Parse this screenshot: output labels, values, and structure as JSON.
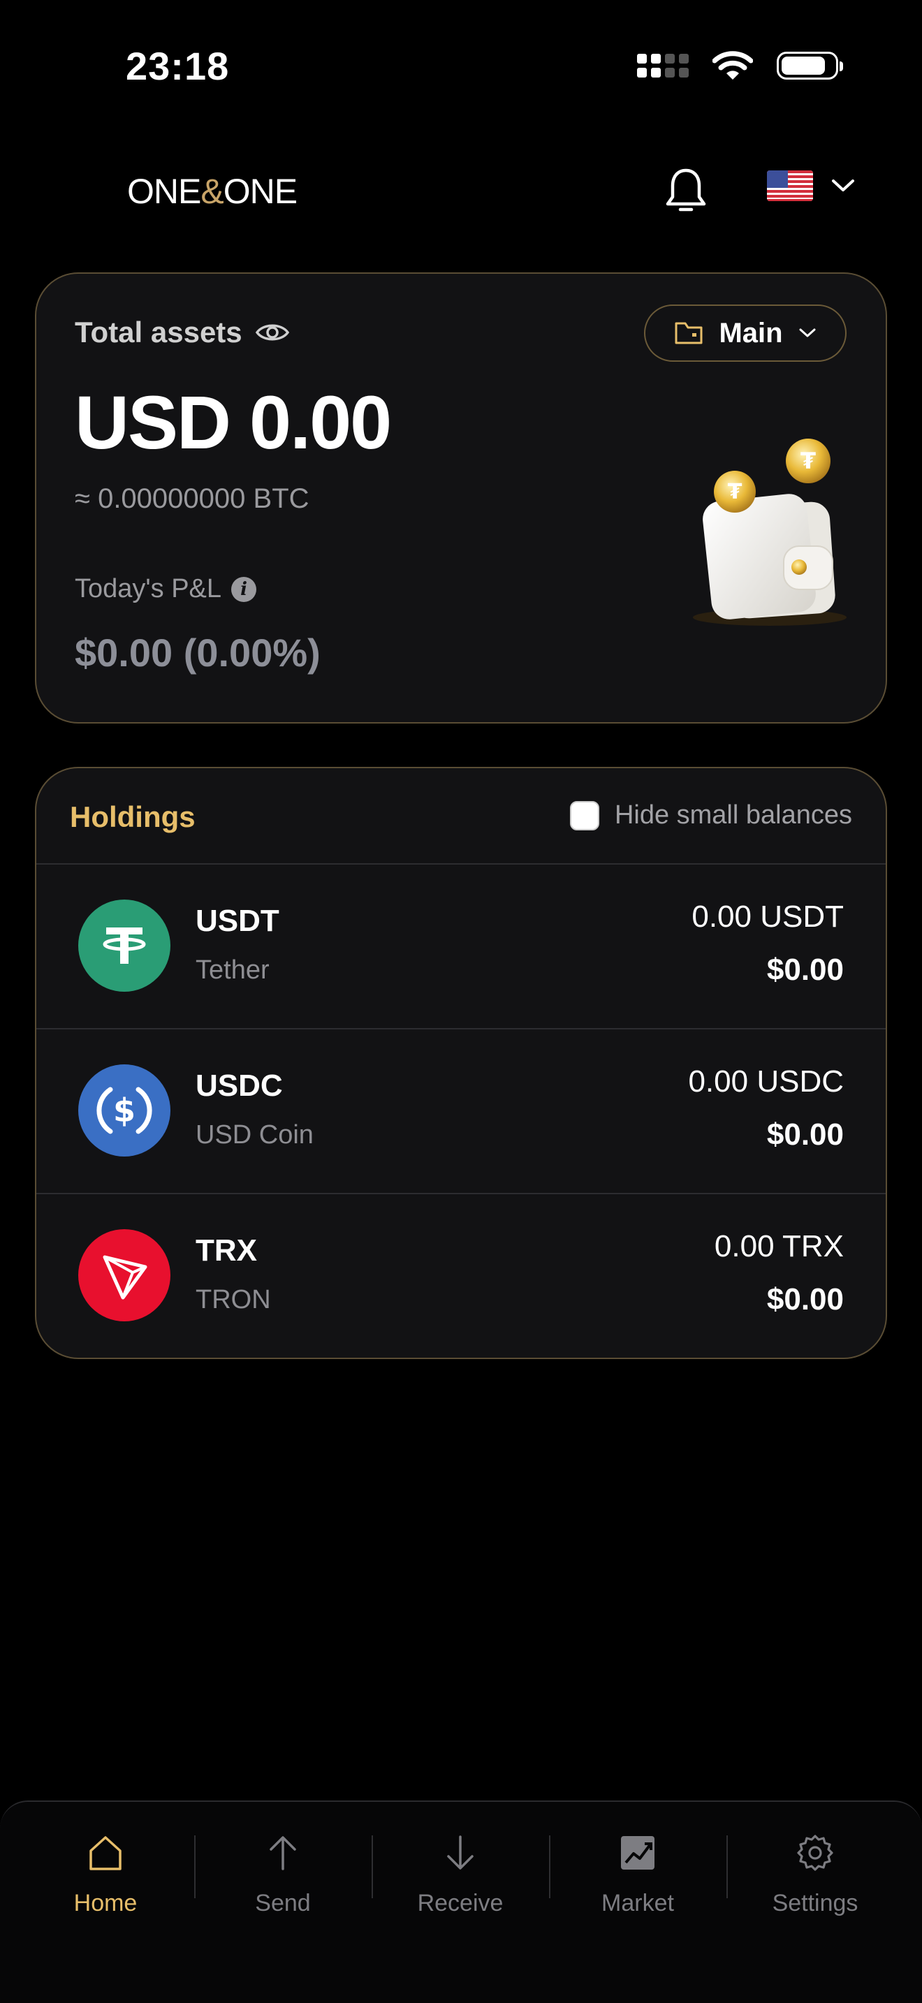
{
  "status_bar": {
    "time": "23:18"
  },
  "header": {
    "logo_text_a": "ONE",
    "logo_text_amp": "&",
    "logo_text_b": "ONE",
    "icons": [
      "bell-icon",
      "us-flag-icon",
      "chevron-down-icon"
    ]
  },
  "assets_card": {
    "label": "Total assets",
    "wallet_selector": "Main",
    "total_value": "USD 0.00",
    "btc_value": "≈ 0.00000000 BTC",
    "pnl_label": "Today's P&L",
    "pnl_value": "$0.00 (0.00%)"
  },
  "holdings": {
    "title": "Holdings",
    "hide_small_label": "Hide small balances",
    "hide_small_checked": false,
    "items": [
      {
        "symbol": "USDT",
        "name": "Tether",
        "amount": "0.00 USDT",
        "usd": "$0.00",
        "icon": "tether-icon",
        "color": "#2a9d75"
      },
      {
        "symbol": "USDC",
        "name": "USD Coin",
        "amount": "0.00 USDC",
        "usd": "$0.00",
        "icon": "usd-coin-icon",
        "color": "#3a6fc4"
      },
      {
        "symbol": "TRX",
        "name": "TRON",
        "amount": "0.00 TRX",
        "usd": "$0.00",
        "icon": "tron-icon",
        "color": "#e8102e"
      }
    ]
  },
  "bottom_nav": {
    "items": [
      {
        "label": "Home",
        "icon": "home-icon",
        "active": true
      },
      {
        "label": "Send",
        "icon": "arrow-up-icon",
        "active": false
      },
      {
        "label": "Receive",
        "icon": "arrow-down-icon",
        "active": false
      },
      {
        "label": "Market",
        "icon": "chart-icon",
        "active": false
      },
      {
        "label": "Settings",
        "icon": "gear-icon",
        "active": false
      }
    ]
  },
  "colors": {
    "accent": "#e7be6a",
    "card_border": "#5a4d34",
    "background": "#000000"
  }
}
